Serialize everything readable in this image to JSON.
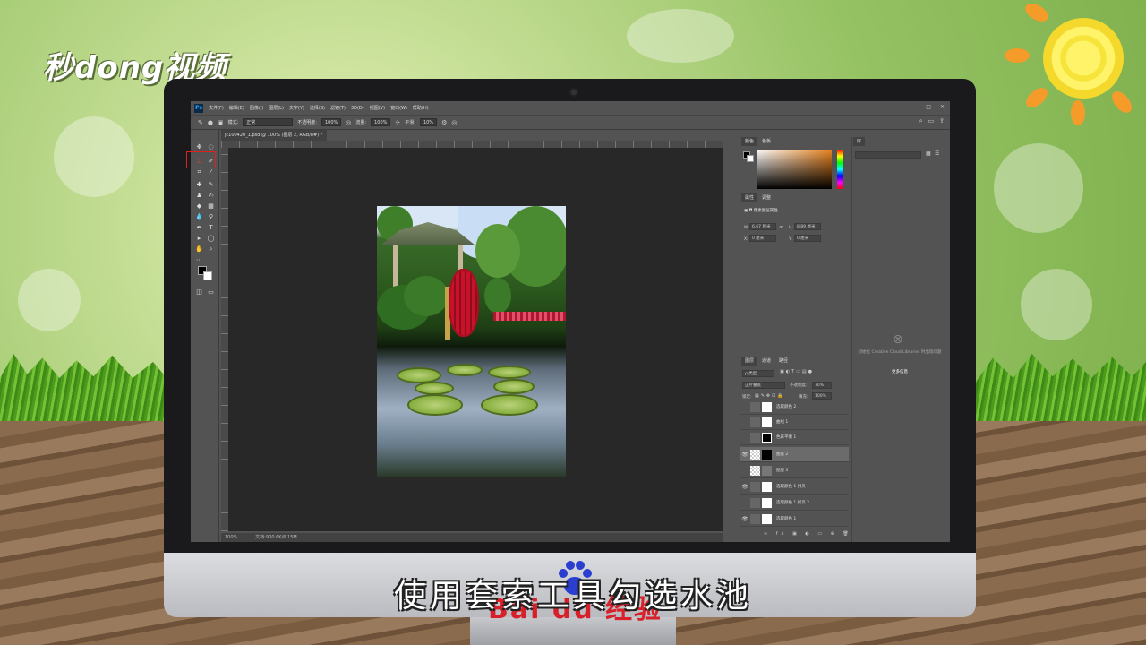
{
  "overlay": {
    "logo_text": "秒dong视频",
    "caption": "使用套索工具勾选水池",
    "watermark_text": "Bai du 经验"
  },
  "menubar": {
    "app_icon": "Ps",
    "items": [
      "文件(F)",
      "编辑(E)",
      "图像(I)",
      "图层(L)",
      "文字(Y)",
      "选择(S)",
      "滤镜(T)",
      "3D(D)",
      "视图(V)",
      "窗口(W)",
      "帮助(H)"
    ],
    "window_buttons": [
      "—",
      "□",
      "✕"
    ]
  },
  "options_bar": {
    "mode_label": "模式:",
    "mode_value": "正常",
    "opacity_label": "不透明度:",
    "opacity_value": "100%",
    "flow_label": "流量:",
    "flow_value": "100%",
    "smooth_label": "平滑:",
    "smooth_value": "10%"
  },
  "document": {
    "tab_title": "jc100420_1.psd @ 100% (图层 2, RGB/8#) *",
    "tab_close": "×",
    "zoom": "100%",
    "doc_size": "文档:900.6K/6.15M"
  },
  "color_panel": {
    "tabs": [
      "颜色",
      "色板"
    ],
    "accent_fg": "#000000",
    "accent_bg": "#ffffff"
  },
  "properties_panel": {
    "tabs": [
      "属性",
      "调整"
    ],
    "header": "像素图层属性",
    "w_label": "W:",
    "w_value": "6.67 厘米",
    "h_label": "H:",
    "h_value": "8.89 厘米",
    "x_label": "X:",
    "x_value": "0 厘米",
    "y_label": "Y:",
    "y_value": "0 厘米"
  },
  "library_panel": {
    "tab": "库",
    "message": "初始化 Creative Cloud Libraries 时出现问题",
    "link": "更多信息"
  },
  "layers_panel": {
    "tabs": [
      "图层",
      "通道",
      "路径"
    ],
    "filter_label": "ρ 类型",
    "blend_mode": "正片叠底",
    "opacity_label": "不透明度:",
    "opacity_value": "70%",
    "lock_label": "锁定:",
    "fill_label": "填充:",
    "fill_value": "100%",
    "layers": [
      {
        "name": "选取颜色 2",
        "visible": false
      },
      {
        "name": "曲线 1",
        "visible": false
      },
      {
        "name": "色彩平衡 1",
        "visible": false
      },
      {
        "name": "图层 2",
        "visible": true
      },
      {
        "name": "图层 3",
        "visible": false
      },
      {
        "name": "选取颜色 1 拷贝",
        "visible": true
      },
      {
        "name": "选取颜色 1 拷贝 2",
        "visible": false
      },
      {
        "name": "选取颜色 1",
        "visible": true
      }
    ]
  }
}
